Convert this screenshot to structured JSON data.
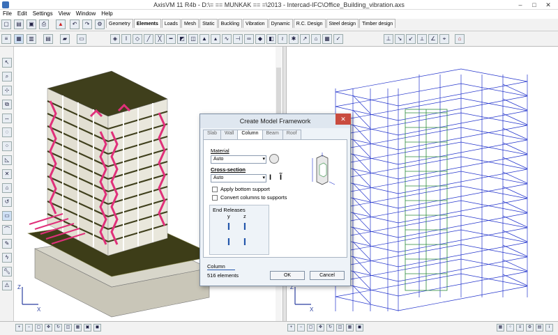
{
  "window": {
    "title": "AxisVM 11 R4b - D:\\= == MUNKAK == =\\2013 - Intercad-IFC\\Office_Building_vibration.axs",
    "minimize": "–",
    "maximize": "□",
    "close": "✕"
  },
  "menu": [
    "File",
    "Edit",
    "Settings",
    "View",
    "Window",
    "Help"
  ],
  "tabs": [
    "Geometry",
    "Elements",
    "Loads",
    "Mesh",
    "Static",
    "Buckling",
    "Vibration",
    "Dynamic",
    "R.C. Design",
    "Steel design",
    "Timber design"
  ],
  "active_tab": "Elements",
  "dialog": {
    "title": "Create Model Framework",
    "close": "✕",
    "tabs": [
      "Slab",
      "Wall",
      "Column",
      "Beam",
      "Roof"
    ],
    "active_tab": "Column",
    "material_label": "Material",
    "material_value": "Auto",
    "cross_section_label": "Cross-section",
    "cross_section_value": "Auto",
    "apply_bottom_support": "Apply bottom support",
    "convert_columns": "Convert columns to supports",
    "end_releases_label": "End Releases",
    "end_releases_y": "y",
    "end_releases_z": "z",
    "footer_type": "Column",
    "footer_count": "516 elements",
    "ok": "OK",
    "cancel": "Cancel"
  },
  "axis": {
    "z": "Z",
    "x": "X"
  },
  "colors": {
    "slab": "#4a4a1f",
    "bracing": "#e0307a",
    "column": "#d9d6c8",
    "wire_blue": "#2233cc",
    "wire_green": "#2a8a3a"
  }
}
